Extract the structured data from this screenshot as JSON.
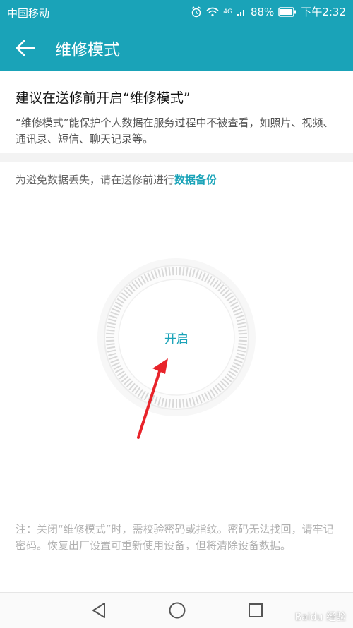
{
  "status": {
    "carrier": "中国移动",
    "network": "4G",
    "battery": "88%",
    "time": "下午2:32"
  },
  "appbar": {
    "title": "维修模式"
  },
  "section": {
    "title": "建议在送修前开启“维修模式”",
    "description": "“维修模式”能保护个人数据在服务过程中不被查看，如照片、视频、通讯录、短信、聊天记录等。"
  },
  "backup": {
    "prefix": "为避免数据丢失，请在送修前进行",
    "link": "数据备份"
  },
  "dial": {
    "label": "开启"
  },
  "note": "注：关闭“维修模式”时，需校验密码或指纹。密码无法找回，请牢记密码。恢复出厂设置可重新使用设备，但将清除设备数据。",
  "watermark": "Baidu 经验",
  "colors": {
    "accent": "#1aa3b8",
    "annotation_arrow": "#e8232a"
  }
}
